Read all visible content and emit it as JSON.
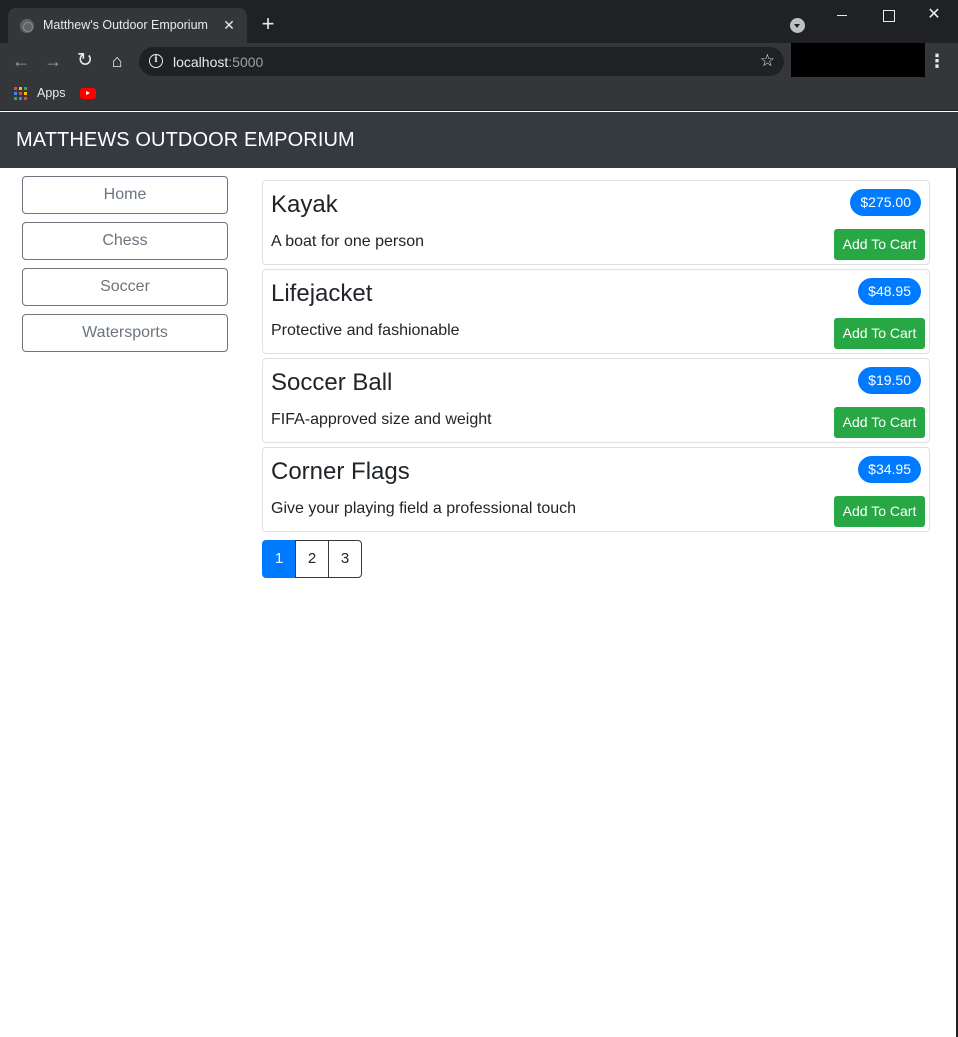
{
  "browser": {
    "tab_title": "Matthew's Outdoor Emporium",
    "url_host": "localhost",
    "url_port": ":5000",
    "bookmarks": [
      {
        "label": "Apps",
        "icon": "apps-grid-icon"
      },
      {
        "label": "",
        "icon": "youtube-icon"
      }
    ]
  },
  "navbar": {
    "brand": "MATTHEWS OUTDOOR EMPORIUM"
  },
  "categories": [
    {
      "label": "Home"
    },
    {
      "label": "Chess"
    },
    {
      "label": "Soccer"
    },
    {
      "label": "Watersports"
    }
  ],
  "products": [
    {
      "name": "Kayak",
      "description": "A boat for one person",
      "price": "$275.00",
      "button": "Add To Cart"
    },
    {
      "name": "Lifejacket",
      "description": "Protective and fashionable",
      "price": "$48.95",
      "button": "Add To Cart"
    },
    {
      "name": "Soccer Ball",
      "description": "FIFA-approved size and weight",
      "price": "$19.50",
      "button": "Add To Cart"
    },
    {
      "name": "Corner Flags",
      "description": "Give your playing field a professional touch",
      "price": "$34.95",
      "button": "Add To Cart"
    }
  ],
  "pagination": {
    "pages": [
      "1",
      "2",
      "3"
    ],
    "active": "1"
  },
  "colors": {
    "navbar": "#343a40",
    "primary": "#007bff",
    "success": "#28a745",
    "outline_secondary": "#6c757d"
  }
}
